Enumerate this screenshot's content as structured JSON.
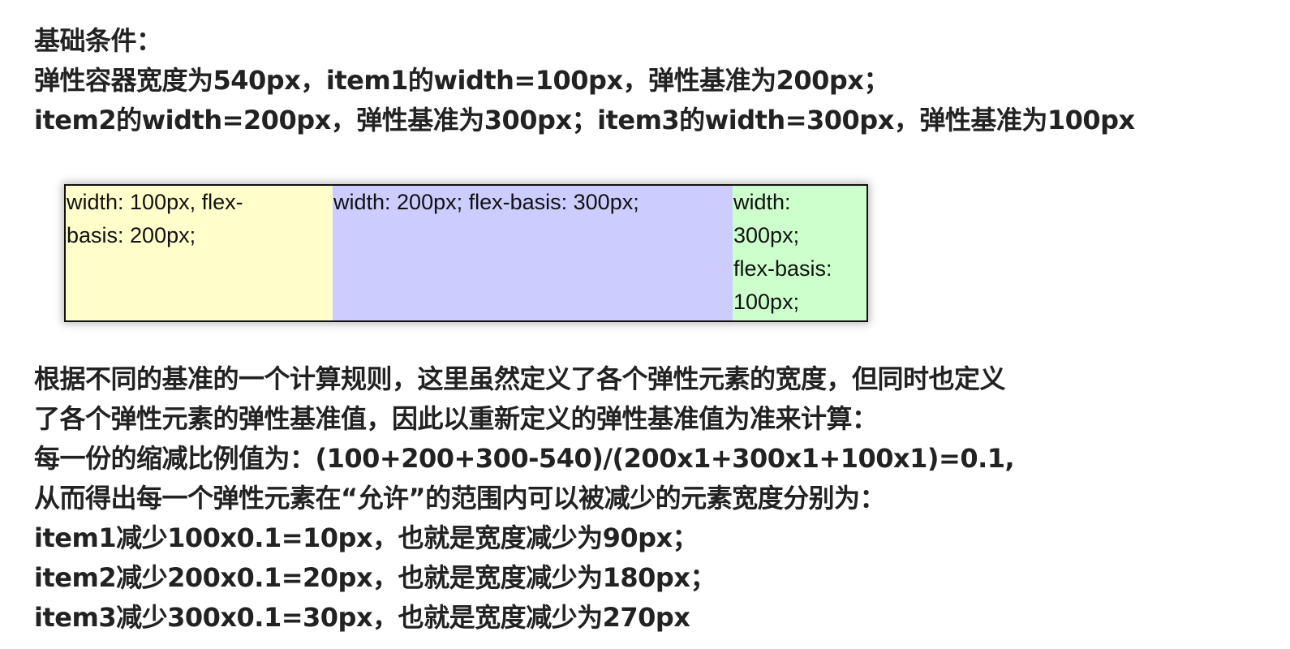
{
  "intro": {
    "lines": [
      "基础条件：",
      "弹性容器宽度为540px，item1的width=100px，弹性基准为200px；",
      "item2的width=200px，弹性基准为300px；item3的width=300px，弹性基准为100px"
    ]
  },
  "demo": {
    "items": [
      {
        "lines": [
          "width: 100px, flex-",
          "basis: 200px;"
        ],
        "color": "#ffffcc"
      },
      {
        "lines": [
          "width: 200px; flex-basis: 300px;"
        ],
        "color": "#ccccff"
      },
      {
        "lines": [
          "width:",
          "300px;",
          "flex-basis:",
          "100px;"
        ],
        "color": "#ccffcc"
      }
    ]
  },
  "explanation": {
    "lines": [
      "根据不同的基准的一个计算规则，这里虽然定义了各个弹性元素的宽度，但同时也定义",
      "了各个弹性元素的弹性基准值，因此以重新定义的弹性基准值为准来计算：",
      "每一份的缩减比例值为：(100+200+300-540)/(200x1+300x1+100x1)=0.1,",
      "从而得出每一个弹性元素在“允许”的范围内可以被减少的元素宽度分别为：",
      "item1减少100x0.1=10px，也就是宽度减少为90px；",
      "item2减少200x0.1=20px，也就是宽度减少为180px；",
      "item3减少300x0.1=30px，也就是宽度减少为270px"
    ]
  }
}
